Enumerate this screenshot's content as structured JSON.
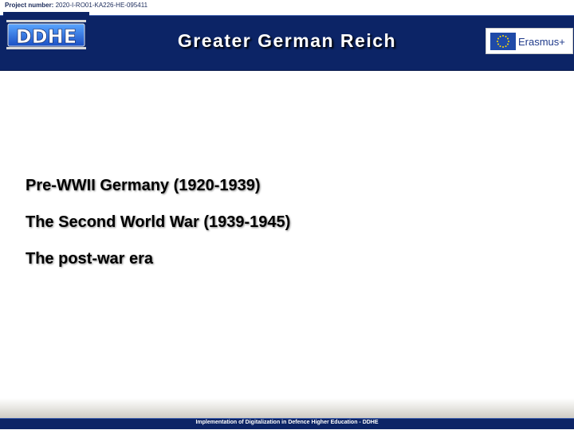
{
  "project": {
    "label": "Project number:",
    "value": "2020-I-RO01-KA226-HE-095411"
  },
  "header": {
    "logo_text": "DDHE",
    "title": "Greater German Reich",
    "partner_logo_text": "Erasmus+"
  },
  "content": {
    "items": [
      "Pre-WWII Germany (1920-1939)",
      "The Second World War (1939-1945)",
      "The post-war era"
    ]
  },
  "footer": {
    "text": "Implementation of Digitalization in Defence Higher Education - DDHE"
  },
  "colors": {
    "header_bg": "#0c2466",
    "title_text": "#ffffff",
    "body_text": "#000000",
    "eu_blue": "#1f4aa8",
    "eu_stars": "#ffdd00"
  }
}
